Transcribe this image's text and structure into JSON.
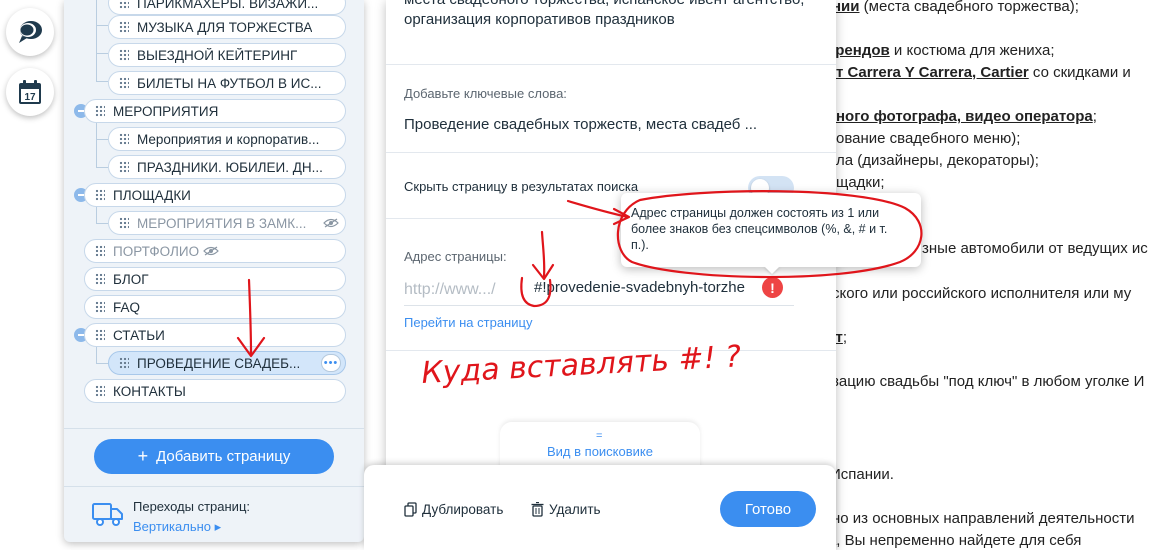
{
  "background_site": {
    "lines": [
      {
        "id": "l1",
        "parts": [
          {
            "t": "нии",
            "b": true,
            "u": true
          },
          {
            "t": " (места свадебного торжества);"
          }
        ]
      },
      {
        "id": "l2",
        "parts": [
          {
            "t": "брендов",
            "b": true,
            "u": true
          },
          {
            "t": " и костюма для жениха;"
          }
        ]
      },
      {
        "id": "l3",
        "parts": [
          {
            "t": "т Carrera Y Carrera, Cartier",
            "b": true,
            "u": true
          },
          {
            "t": " со скидками и"
          }
        ]
      },
      {
        "id": "l4",
        "parts": [
          {
            "t": "ного фотографа, видео оператора",
            "b": true,
            "u": true
          },
          {
            "t": ";"
          }
        ]
      },
      {
        "id": "l5",
        "parts": [
          {
            "t": "ование свадебного меню);"
          }
        ]
      },
      {
        "id": "l6",
        "parts": [
          {
            "t": "ла (дизайнеры, декораторы);"
          }
        ]
      },
      {
        "id": "l7",
        "parts": [
          {
            "t": "щадки;"
          }
        ]
      },
      {
        "id": "l8",
        "parts": [
          {
            "t": "зные автомобили от ведущих ис"
          }
        ]
      },
      {
        "id": "l9",
        "parts": [
          {
            "t": "ского или российского исполнителя или му"
          }
        ]
      },
      {
        "id": "l10",
        "parts": [
          {
            "t": "кт",
            "b": true,
            "u": true
          },
          {
            "t": ";"
          }
        ]
      },
      {
        "id": "l11",
        "parts": [
          {
            "t": "зацию свадьбы \"под ключ\" в любом уголке И"
          }
        ]
      },
      {
        "id": "l12",
        "parts": [
          {
            "t": "Испании."
          }
        ]
      },
      {
        "id": "l13",
        "parts": [
          {
            "t": "но из основных направлений деятельности"
          }
        ]
      },
      {
        "id": "l14",
        "parts": [
          {
            "t": "Испании. Выбрав Испанию для корпоратива или праздника, Вы непременно найдете для себя"
          }
        ]
      }
    ]
  },
  "tools": [
    {
      "id": "chat",
      "icon": "chat-bubbles-icon"
    },
    {
      "id": "calendar",
      "icon": "calendar-icon",
      "day": "17"
    }
  ],
  "pages_panel": {
    "items": [
      {
        "label": "ПАРИКМАХЕРЫ. ВИЗАЖИ...",
        "level": 1
      },
      {
        "label": "МУЗЫКА ДЛЯ ТОРЖЕСТВА",
        "level": 1
      },
      {
        "label": "ВЫЕЗДНОЙ КЕЙТЕРИНГ",
        "level": 1
      },
      {
        "label": "БИЛЕТЫ НА ФУТБОЛ В ИС...",
        "level": 1
      },
      {
        "label": "МЕРОПРИЯТИЯ",
        "level": 0
      },
      {
        "label": "Мероприятия и корпоратив...",
        "level": 1
      },
      {
        "label": "ПРАЗДНИКИ. ЮБИЛЕИ. ДН...",
        "level": 1
      },
      {
        "label": "ПЛОЩАДКИ",
        "level": 0
      },
      {
        "label": "МЕРОПРИЯТИЯ В ЗАМК...",
        "level": 1,
        "hidden": true
      },
      {
        "label": "ПОРТФОЛИО",
        "level": 0,
        "hidden": true
      },
      {
        "label": "БЛОГ",
        "level": 0
      },
      {
        "label": "FAQ",
        "level": 0
      },
      {
        "label": "СТАТЬИ",
        "level": 0
      },
      {
        "label": "ПРОВЕДЕНИЕ СВАДЕБ...",
        "level": 1,
        "selected": true
      },
      {
        "label": "КОНТАКТЫ",
        "level": 0
      }
    ],
    "add_page_label": "Добавить страницу",
    "transitions_title": "Переходы страниц:",
    "transitions_value": "Вертикально ▸"
  },
  "seo_panel": {
    "description_text": "места свадебного торжества, испанское ивент агентство, организация корпоративов праздников",
    "keywords_label": "Добавьте ключевые слова:",
    "keywords_value": "Проведение свадебных торжеств, места свадеб ...",
    "hide_label": "Скрыть страницу в результатах поиска",
    "hide_toggle_on": false,
    "url_label": "Адрес страницы:",
    "url_prefix": "http://www.../",
    "url_value": "#!provedenie-svadebnyh-torzhe",
    "error_mark": "!",
    "goto_link": "Перейти на страницу",
    "search_view_handle": "=",
    "search_view_label": "Вид в поисковике",
    "duplicate_label": "Дублировать",
    "delete_label": "Удалить",
    "done_label": "Готово"
  },
  "tooltip": {
    "text": "Адрес страницы должен состоять из 1 или более знаков без спецсимволов (%, &, # и т. п.)."
  },
  "annotation": {
    "handwritten_text": "Куда вставлять #! ?",
    "color": "#e0151b"
  },
  "colors": {
    "accent": "#3b8ef0",
    "error": "#ee4444",
    "panel_bg": "#eef3f8"
  }
}
